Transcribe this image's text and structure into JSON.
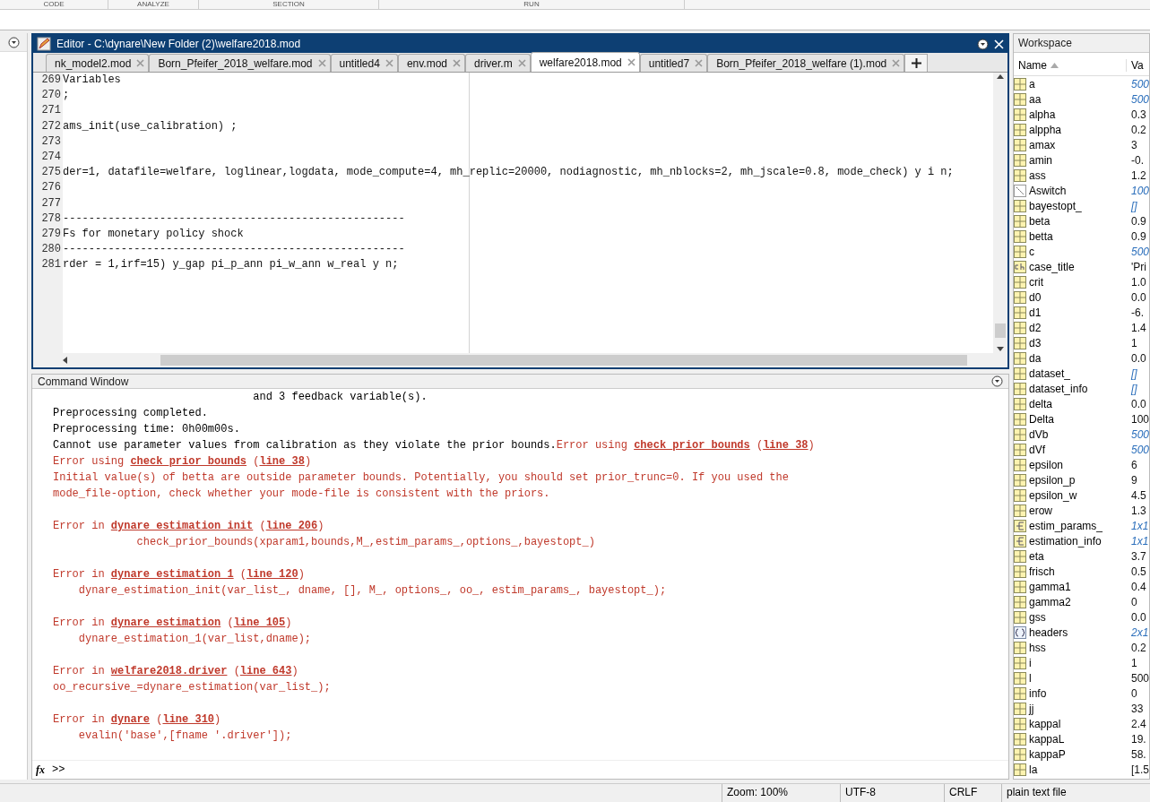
{
  "toolstrip": {
    "sections": [
      "CODE",
      "ANALYZE",
      "SECTION",
      "RUN"
    ]
  },
  "editor": {
    "title": "Editor - C:\\dynare\\New Folder (2)\\welfare2018.mod",
    "tabs": [
      {
        "label": "nk_model2.mod",
        "selected": false
      },
      {
        "label": "Born_Pfeifer_2018_welfare.mod",
        "selected": false
      },
      {
        "label": "untitled4",
        "selected": false
      },
      {
        "label": "env.mod",
        "selected": false
      },
      {
        "label": "driver.m",
        "selected": false
      },
      {
        "label": "welfare2018.mod",
        "selected": true
      },
      {
        "label": "untitled7",
        "selected": false
      },
      {
        "label": "Born_Pfeifer_2018_welfare (1).mod",
        "selected": false
      }
    ],
    "lines": [
      {
        "number": "269",
        "text": "Variables"
      },
      {
        "number": "270",
        "text": ";"
      },
      {
        "number": "271"
      },
      {
        "number": "272",
        "text": "ams_init(use_calibration) ;"
      },
      {
        "number": "273"
      },
      {
        "number": "274"
      },
      {
        "number": "275",
        "text": "der=1, datafile=welfare, loglinear,logdata, mode_compute=4, mh_replic=20000, nodiagnostic, mh_nblocks=2, mh_jscale=0.8, mode_check) y i n;"
      },
      {
        "number": "276"
      },
      {
        "number": "277"
      },
      {
        "number": "278",
        "text": "-----------------------------------------------------"
      },
      {
        "number": "279",
        "text": "Fs for monetary policy shock"
      },
      {
        "number": "280",
        "text": "-----------------------------------------------------"
      },
      {
        "number": "281",
        "text": "rder = 1,irf=15) y_gap pi_p_ann pi_w_ann w_real y n;"
      }
    ]
  },
  "command_window": {
    "title": "Command Window",
    "function_label": "fx",
    "prompt": ">>",
    "blocks": [
      {
        "lines": [
          {
            "segments": [
              {
                "kind": "plain",
                "text": "                               and 3 feedback variable(s)."
              }
            ]
          },
          {
            "segments": [
              {
                "kind": "plain",
                "text": "Preprocessing completed."
              }
            ]
          },
          {
            "segments": [
              {
                "kind": "plain",
                "text": "Preprocessing time: 0h00m00s."
              }
            ]
          },
          {
            "segments": [
              {
                "kind": "plain",
                "text": "Cannot use parameter values from calibration as they violate the prior bounds."
              },
              {
                "kind": "error",
                "text": "Error using "
              },
              {
                "kind": "link",
                "text": "check_prior_bounds"
              },
              {
                "kind": "error",
                "text": " ("
              },
              {
                "kind": "link",
                "text": "line 38"
              },
              {
                "kind": "error",
                "text": ")"
              }
            ]
          },
          {
            "segments": [
              {
                "kind": "error",
                "text": "Error using "
              },
              {
                "kind": "link",
                "text": "check_prior_bounds"
              },
              {
                "kind": "error",
                "text": " ("
              },
              {
                "kind": "link",
                "text": "line 38"
              },
              {
                "kind": "error",
                "text": ")"
              }
            ]
          },
          {
            "segments": [
              {
                "kind": "error",
                "text": "Initial value(s) of betta are outside parameter bounds. Potentially, you should set prior_trunc=0. If you used the"
              }
            ]
          },
          {
            "segments": [
              {
                "kind": "error",
                "text": "mode_file-option, check whether your mode-file is consistent with the priors."
              }
            ]
          }
        ]
      },
      {
        "lines": [
          {
            "segments": [
              {
                "kind": "error",
                "text": "Error in "
              },
              {
                "kind": "link",
                "text": "dynare_estimation_init"
              },
              {
                "kind": "error",
                "text": " ("
              },
              {
                "kind": "link",
                "text": "line 206"
              },
              {
                "kind": "error",
                "text": ")"
              }
            ]
          },
          {
            "segments": [
              {
                "kind": "error",
                "text": "             check_prior_bounds(xparam1,bounds,M_,estim_params_,options_,bayestopt_)"
              }
            ]
          }
        ]
      },
      {
        "lines": [
          {
            "segments": [
              {
                "kind": "error",
                "text": "Error in "
              },
              {
                "kind": "link",
                "text": "dynare_estimation_1"
              },
              {
                "kind": "error",
                "text": " ("
              },
              {
                "kind": "link",
                "text": "line 120"
              },
              {
                "kind": "error",
                "text": ")"
              }
            ]
          },
          {
            "segments": [
              {
                "kind": "error",
                "text": "    dynare_estimation_init(var_list_, dname, [], M_, options_, oo_, estim_params_, bayestopt_);"
              }
            ]
          }
        ]
      },
      {
        "lines": [
          {
            "segments": [
              {
                "kind": "error",
                "text": "Error in "
              },
              {
                "kind": "link",
                "text": "dynare_estimation"
              },
              {
                "kind": "error",
                "text": " ("
              },
              {
                "kind": "link",
                "text": "line 105"
              },
              {
                "kind": "error",
                "text": ")"
              }
            ]
          },
          {
            "segments": [
              {
                "kind": "error",
                "text": "    dynare_estimation_1(var_list,dname);"
              }
            ]
          }
        ]
      },
      {
        "lines": [
          {
            "segments": [
              {
                "kind": "error",
                "text": "Error in "
              },
              {
                "kind": "link",
                "text": "welfare2018.driver"
              },
              {
                "kind": "error",
                "text": " ("
              },
              {
                "kind": "link",
                "text": "line 643"
              },
              {
                "kind": "error",
                "text": ")"
              }
            ]
          },
          {
            "segments": [
              {
                "kind": "error",
                "text": "oo_recursive_=dynare_estimation(var_list_);"
              }
            ]
          }
        ]
      },
      {
        "lines": [
          {
            "segments": [
              {
                "kind": "error",
                "text": "Error in "
              },
              {
                "kind": "link",
                "text": "dynare"
              },
              {
                "kind": "error",
                "text": " ("
              },
              {
                "kind": "link",
                "text": "line 310"
              },
              {
                "kind": "error",
                "text": ")"
              }
            ]
          },
          {
            "segments": [
              {
                "kind": "error",
                "text": "    evalin('base',[fname '.driver']);"
              }
            ]
          }
        ]
      }
    ]
  },
  "workspace": {
    "title": "Workspace",
    "columns": [
      "Name",
      "Va"
    ],
    "rows": [
      {
        "kind": "matrix",
        "name": "a",
        "value": "500",
        "italic": true
      },
      {
        "kind": "matrix",
        "name": "aa",
        "value": "500",
        "italic": true
      },
      {
        "kind": "matrix",
        "name": "alpha",
        "value": "0.3",
        "italic": false
      },
      {
        "kind": "matrix",
        "name": "alppha",
        "value": "0.2",
        "italic": false
      },
      {
        "kind": "matrix",
        "name": "amax",
        "value": "3",
        "italic": false
      },
      {
        "kind": "matrix",
        "name": "amin",
        "value": "-0.",
        "italic": false
      },
      {
        "kind": "matrix",
        "name": "ass",
        "value": "1.2",
        "italic": false
      },
      {
        "kind": "sparse",
        "name": "Aswitch",
        "value": "100",
        "italic": true
      },
      {
        "kind": "matrix",
        "name": "bayestopt_",
        "value": "[]",
        "italic": true
      },
      {
        "kind": "matrix",
        "name": "beta",
        "value": "0.9",
        "italic": false
      },
      {
        "kind": "matrix",
        "name": "betta",
        "value": "0.9",
        "italic": false
      },
      {
        "kind": "matrix",
        "name": "c",
        "value": "500",
        "italic": true
      },
      {
        "kind": "char",
        "name": "case_title",
        "value": "'Pri",
        "italic": false
      },
      {
        "kind": "matrix",
        "name": "crit",
        "value": "1.0",
        "italic": false
      },
      {
        "kind": "matrix",
        "name": "d0",
        "value": "0.0",
        "italic": false
      },
      {
        "kind": "matrix",
        "name": "d1",
        "value": "-6.",
        "italic": false
      },
      {
        "kind": "matrix",
        "name": "d2",
        "value": "1.4",
        "italic": false
      },
      {
        "kind": "matrix",
        "name": "d3",
        "value": "1",
        "italic": false
      },
      {
        "kind": "matrix",
        "name": "da",
        "value": "0.0",
        "italic": false
      },
      {
        "kind": "matrix",
        "name": "dataset_",
        "value": "[]",
        "italic": true
      },
      {
        "kind": "matrix",
        "name": "dataset_info",
        "value": "[]",
        "italic": true
      },
      {
        "kind": "matrix",
        "name": "delta",
        "value": "0.0",
        "italic": false
      },
      {
        "kind": "matrix",
        "name": "Delta",
        "value": "100",
        "italic": false
      },
      {
        "kind": "matrix",
        "name": "dVb",
        "value": "500",
        "italic": true
      },
      {
        "kind": "matrix",
        "name": "dVf",
        "value": "500",
        "italic": true
      },
      {
        "kind": "matrix",
        "name": "epsilon",
        "value": "6",
        "italic": false
      },
      {
        "kind": "matrix",
        "name": "epsilon_p",
        "value": "9",
        "italic": false
      },
      {
        "kind": "matrix",
        "name": "epsilon_w",
        "value": "4.5",
        "italic": false
      },
      {
        "kind": "matrix",
        "name": "erow",
        "value": "1.3",
        "italic": false
      },
      {
        "kind": "struct",
        "name": "estim_params_",
        "value": "1x1",
        "italic": true
      },
      {
        "kind": "struct",
        "name": "estimation_info",
        "value": "1x1",
        "italic": true
      },
      {
        "kind": "matrix",
        "name": "eta",
        "value": "3.7",
        "italic": false
      },
      {
        "kind": "matrix",
        "name": "frisch",
        "value": "0.5",
        "italic": false
      },
      {
        "kind": "matrix",
        "name": "gamma1",
        "value": "0.4",
        "italic": false
      },
      {
        "kind": "matrix",
        "name": "gamma2",
        "value": "0",
        "italic": false
      },
      {
        "kind": "matrix",
        "name": "gss",
        "value": "0.0",
        "italic": false
      },
      {
        "kind": "cell",
        "name": "headers",
        "value": "2x1",
        "italic": true
      },
      {
        "kind": "matrix",
        "name": "hss",
        "value": "0.2",
        "italic": false
      },
      {
        "kind": "matrix",
        "name": "i",
        "value": "1",
        "italic": false
      },
      {
        "kind": "matrix",
        "name": "l",
        "value": "500",
        "italic": false
      },
      {
        "kind": "matrix",
        "name": "info",
        "value": "0",
        "italic": false
      },
      {
        "kind": "matrix",
        "name": "jj",
        "value": "33",
        "italic": false
      },
      {
        "kind": "matrix",
        "name": "kappal",
        "value": "2.4",
        "italic": false
      },
      {
        "kind": "matrix",
        "name": "kappaL",
        "value": "19.",
        "italic": false
      },
      {
        "kind": "matrix",
        "name": "kappaP",
        "value": "58.",
        "italic": false
      },
      {
        "kind": "matrix",
        "name": "la",
        "value": "[1.5",
        "italic": false
      }
    ]
  },
  "status_bar": [
    "Zoom: 100%",
    "UTF-8",
    "CRLF",
    "plain text file"
  ]
}
